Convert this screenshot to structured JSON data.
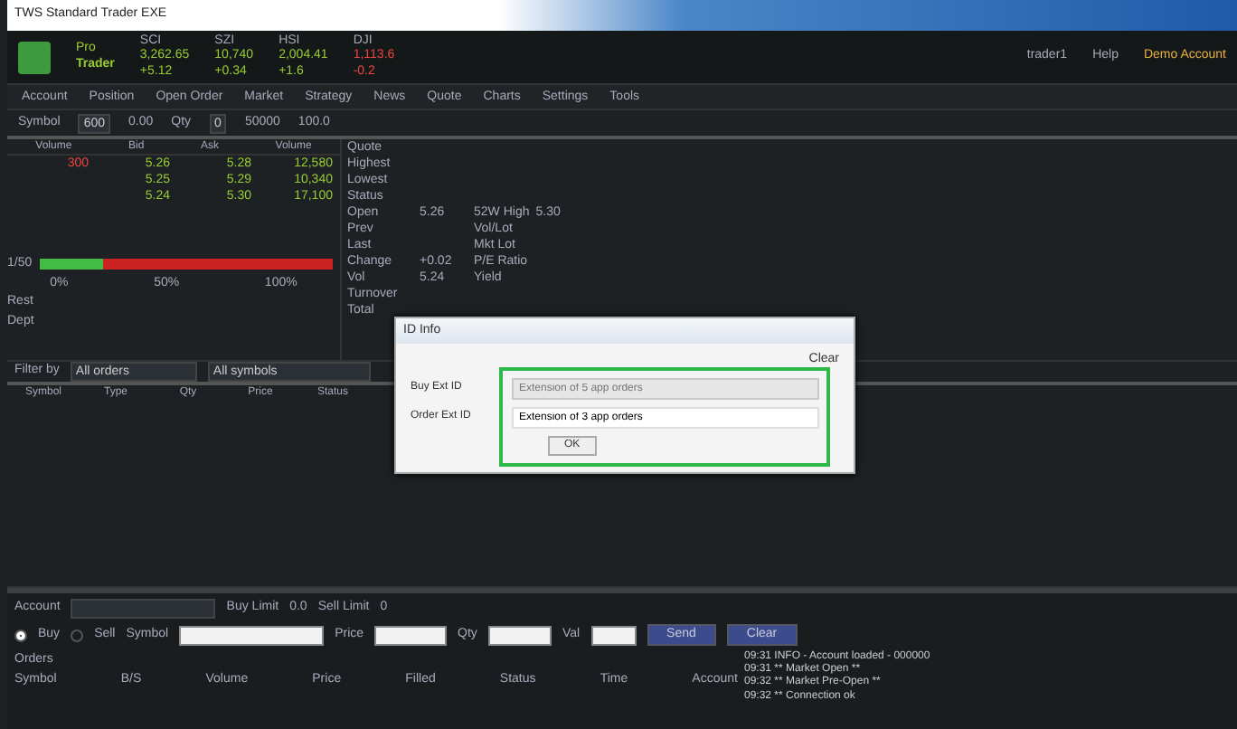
{
  "window": {
    "title": "TWS Standard Trader EXE"
  },
  "header": {
    "logo_top": "Pro",
    "logo": "Trader",
    "tickers": [
      {
        "name": "SCI",
        "value": "3,262.65",
        "change": "+5.12",
        "up": true
      },
      {
        "name": "SZI",
        "value": "10,740",
        "change": "+0.34",
        "up": true
      },
      {
        "name": "HSI",
        "value": "2,004.41",
        "change": "+1.6",
        "up": true
      },
      {
        "name": "DJI",
        "value": "1,113.6",
        "change": "-0.2",
        "up": false
      }
    ],
    "user": "trader1",
    "help": "Help",
    "account": "Demo Account"
  },
  "menu": [
    "Account",
    "Position",
    "Open Order",
    "Market",
    "Strategy",
    "News",
    "Quote",
    "Charts",
    "Settings",
    "Tools"
  ],
  "toolbar": {
    "symbol_label": "Symbol",
    "symbol": "600",
    "last_label": "0.00",
    "qty_label": "Qty",
    "qty": "0",
    "range_label": "50000",
    "unit": "100.0"
  },
  "book": {
    "columns": [
      "Volume",
      "Bid",
      "Ask",
      "Volume"
    ],
    "rows": [
      {
        "bid_qty": "300",
        "bid": "5.26",
        "ask": "5.28",
        "ask_qty": "12,580"
      },
      {
        "bid": "5.25",
        "ask": "5.29",
        "ask_qty": "10,340"
      },
      {
        "bid": "5.24",
        "ask": "5.30",
        "ask_qty": "17,100"
      }
    ],
    "ratio": {
      "label": "1/50",
      "level": 0.22
    },
    "scale": [
      "0%",
      "50%",
      "100%"
    ],
    "labels": [
      "Rest",
      "Dept"
    ]
  },
  "quote": {
    "rows": [
      {
        "label": "Quote"
      },
      {
        "label": "Highest"
      },
      {
        "label": "Lowest"
      },
      {
        "label": "Status"
      },
      {
        "label": "Open",
        "value": "5.26",
        "field": "52W High",
        "extra": "5.30"
      },
      {
        "label": "Prev",
        "field": "Vol/Lot"
      },
      {
        "label": "Last",
        "field": "Mkt Lot"
      },
      {
        "label": "Change",
        "value": "+0.02",
        "field": "P/E Ratio"
      },
      {
        "label": "Vol",
        "value": "5.24",
        "field": "Yield"
      },
      {
        "label": "Turnover"
      },
      {
        "label": "Total"
      }
    ]
  },
  "orders": {
    "filter_label": "Filter by",
    "filter": "All orders",
    "filter2": "All symbols",
    "columns": [
      "Symbol",
      "Type",
      "Qty",
      "Price",
      "Status"
    ]
  },
  "dialog": {
    "title": "ID Info",
    "clear": "Clear",
    "fields": [
      {
        "label": "Buy Ext ID",
        "placeholder": "Extension of 5 app orders",
        "disabled": true
      },
      {
        "label": "Order Ext ID",
        "value": "Extension of 3 app orders",
        "disabled": false
      }
    ],
    "button": "OK"
  },
  "bottom": {
    "account_label": "Account",
    "buy_label": "Buy Limit",
    "buy_value": "0.0",
    "sell_label": "Sell Limit",
    "sell_value": "0",
    "sides": [
      {
        "label": "Buy",
        "selected": true
      },
      {
        "label": "Sell",
        "selected": false
      }
    ],
    "symbol_label": "Symbol",
    "price_label": "Price",
    "qty_label": "Qty",
    "val_label": "Val",
    "buttons": [
      "Send",
      "Clear"
    ],
    "grid_label": "Orders",
    "grid_cols": [
      "Symbol",
      "B/S",
      "Volume",
      "Price",
      "Filled",
      "Status",
      "Time",
      "Account"
    ],
    "log": [
      "09:31 INFO - Account loaded - 000000",
      "09:31 ** Market Open **",
      "09:32 ** Market Pre-Open **",
      "09:32 ** Connection ok"
    ]
  }
}
